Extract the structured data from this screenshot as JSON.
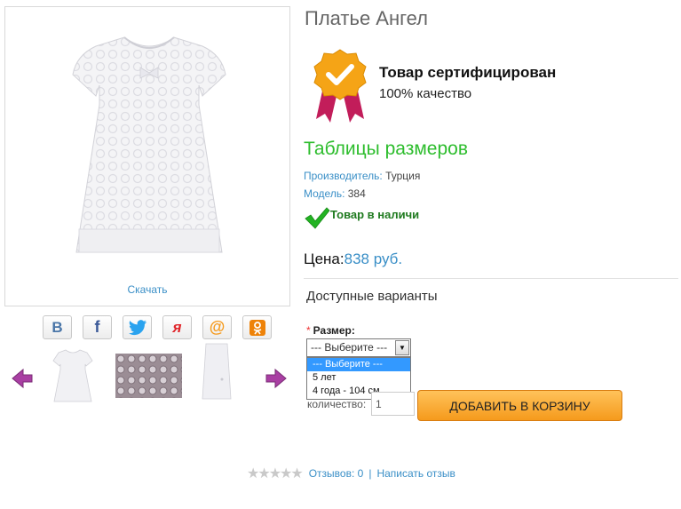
{
  "product": {
    "title": "Платье Ангел",
    "download_label": "Скачать"
  },
  "share": [
    {
      "icon": "vk-icon",
      "glyph": "B",
      "color": "#4a76a8"
    },
    {
      "icon": "facebook-icon",
      "glyph": "f",
      "color": "#3b5998"
    },
    {
      "icon": "twitter-icon",
      "glyph": "🐦",
      "color": "#1da1f2"
    },
    {
      "icon": "yaru-icon",
      "glyph": "я",
      "color": "#e0262b"
    },
    {
      "icon": "mailru-icon",
      "glyph": "@",
      "color": "#f59a1c"
    },
    {
      "icon": "odnoklassniki-icon",
      "glyph": "ок",
      "color": "#ee8208"
    }
  ],
  "certificate": {
    "title": "Товар сертифицирован",
    "subtitle": "100% качество"
  },
  "size_tables_label": "Таблицы размеров",
  "specs": {
    "maker_key": "Производитель:",
    "maker_value": " Турция",
    "model_key": "Модель:",
    "model_value": " 384"
  },
  "stock_text": "Товар в наличи",
  "price": {
    "label": "Цена:",
    "value": "838 руб."
  },
  "variants": {
    "title": "Доступные варианты",
    "size_label": "Размер:",
    "selected": "--- Выберите ---",
    "options": [
      "--- Выберите ---",
      "5 лет",
      "4 года - 104 см"
    ]
  },
  "quantity": {
    "label": "количество:",
    "value": "1"
  },
  "cart_button": "ДОБАВИТЬ В КОРЗИНУ",
  "reviews": {
    "stars": "★★★★★",
    "count_label": "Отзывов: 0",
    "separator": "|",
    "write_label": "Написать отзыв"
  },
  "colors": {
    "link": "#3a8fc7",
    "green": "#2dbd2d",
    "cart": "#f59a1c"
  }
}
